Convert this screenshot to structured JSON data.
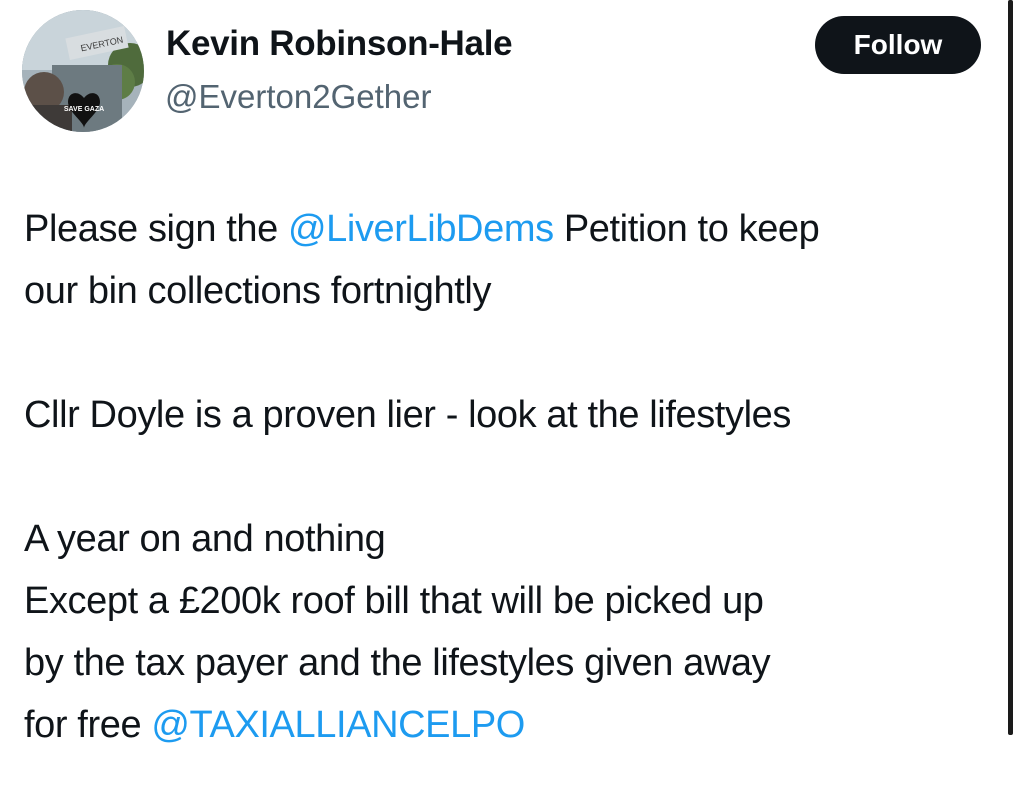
{
  "author": {
    "display_name": "Kevin Robinson-Hale",
    "handle": "@Everton2Gether",
    "avatar_badge_text": "SAVE GAZA"
  },
  "follow_label": "Follow",
  "tweet": {
    "line1_prefix": "Please sign the ",
    "mention1": "@LiverLibDems",
    "line1_suffix": " Petition to keep",
    "line2": "our bin collections fortnightly",
    "para2": "Cllr Doyle is a proven lier - look at the lifestyles",
    "para3_line1": "A year on and nothing",
    "para3_line2": "Except a £200k roof bill that will be picked up",
    "para3_line3": "by the tax payer and the lifestyles given away",
    "para3_prefix": "for free ",
    "mention2": "@TAXIALLIANCELPO"
  },
  "colors": {
    "link": "#1d9bf0",
    "follow_bg": "#0f1419",
    "handle": "#536471"
  }
}
